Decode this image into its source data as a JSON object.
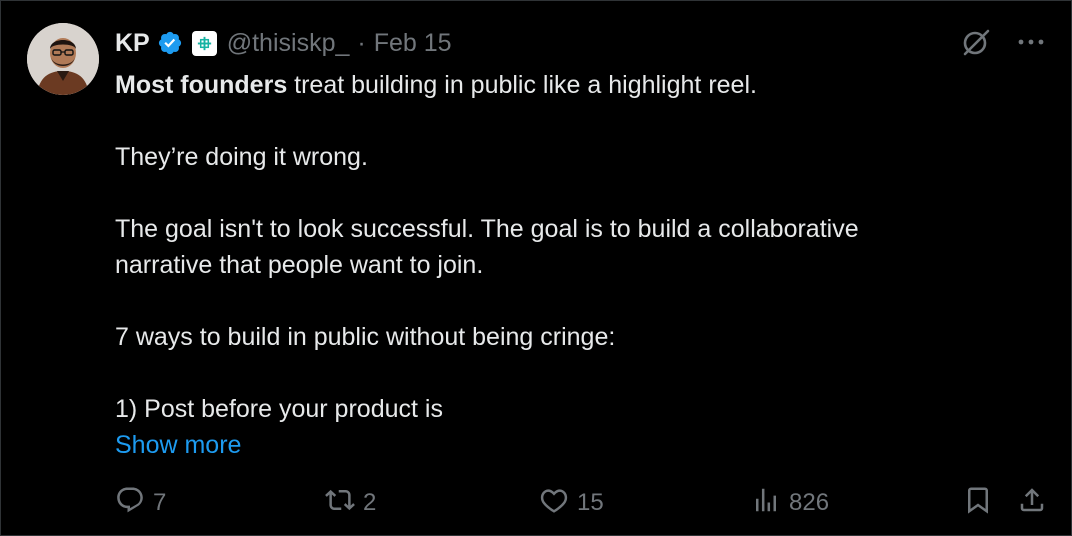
{
  "author": {
    "name": "KP",
    "handle": "@thisiskp_",
    "separator": "·",
    "date": "Feb 15"
  },
  "colors": {
    "background": "#000000",
    "text": "#e7e9ea",
    "muted": "#71767b",
    "link": "#1d9bf0",
    "verified": "#1d9bf0"
  },
  "tweet": {
    "lead_bold": "Most founders",
    "lead_rest": " treat building in public like a highlight reel.",
    "line2": "They’re doing it wrong.",
    "line3a": "The goal isn't to look successful. The goal is to build a collaborative",
    "line3b": "narrative that people want to join.",
    "line4": "7 ways to build in public without being cringe:",
    "line5": "1) Post before your product is",
    "show_more": "Show more"
  },
  "actions": {
    "replies": "7",
    "retweets": "2",
    "likes": "15",
    "views": "826"
  },
  "icons": {
    "verified": "verified-badge-icon",
    "affiliation": "affiliation-logo-icon",
    "grok": "grok-icon",
    "more": "more-options-icon",
    "reply": "reply-icon",
    "retweet": "retweet-icon",
    "like": "heart-icon",
    "views": "views-icon",
    "bookmark": "bookmark-icon",
    "share": "share-icon"
  }
}
